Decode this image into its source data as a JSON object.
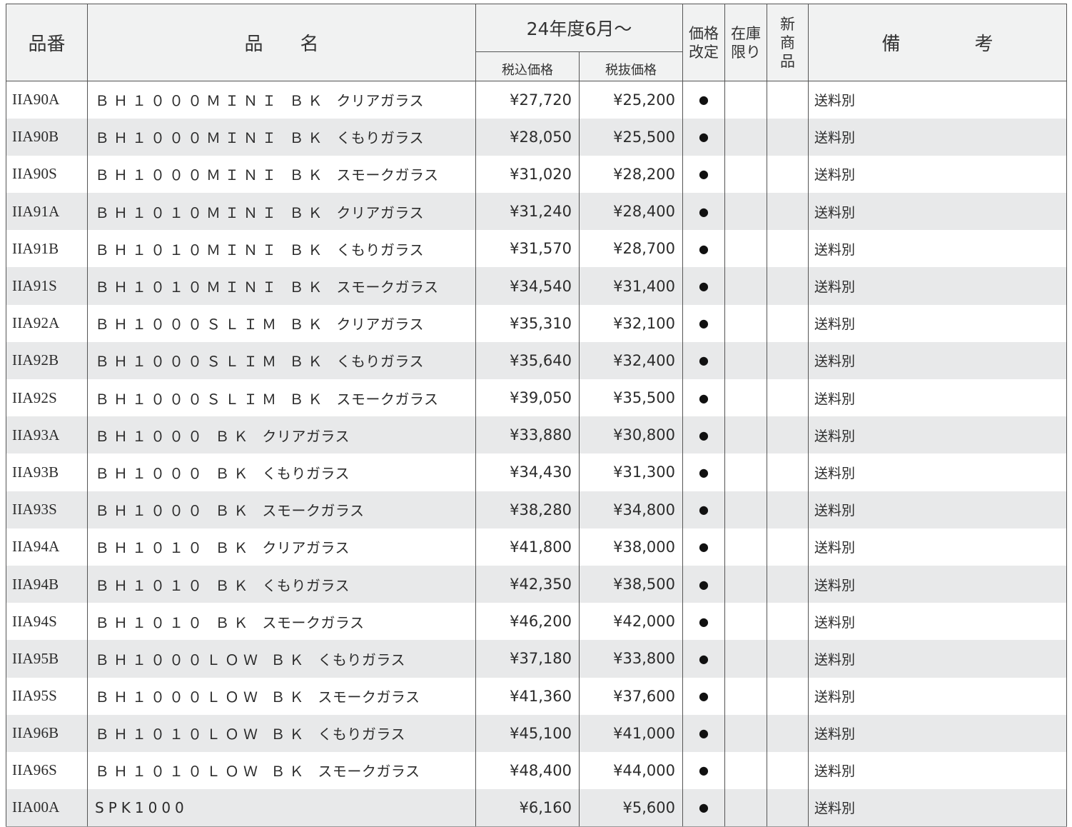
{
  "header": {
    "code": "品番",
    "name": "品　　名",
    "period": "24年度6月～",
    "tax_incl": "税込価格",
    "tax_excl": "税抜価格",
    "revision_1": "価格",
    "revision_2": "改定",
    "stock_1": "在庫",
    "stock_2": "限り",
    "new_1": "新",
    "new_2": "商",
    "new_3": "品",
    "remarks": "備　　　　考"
  },
  "rows": [
    {
      "code": "IIA90A",
      "model": "ＢＨ１０００ＭＩＮＩ ＢＫ",
      "desc": "クリアガラス",
      "incl": "¥27,720",
      "excl": "¥25,200",
      "revision": "●",
      "stock": "",
      "new": "",
      "remark": "送料別"
    },
    {
      "code": "IIA90B",
      "model": "ＢＨ１０００ＭＩＮＩ ＢＫ",
      "desc": "くもりガラス",
      "incl": "¥28,050",
      "excl": "¥25,500",
      "revision": "●",
      "stock": "",
      "new": "",
      "remark": "送料別"
    },
    {
      "code": "IIA90S",
      "model": "ＢＨ１０００ＭＩＮＩ ＢＫ",
      "desc": "スモークガラス",
      "incl": "¥31,020",
      "excl": "¥28,200",
      "revision": "●",
      "stock": "",
      "new": "",
      "remark": "送料別"
    },
    {
      "code": "IIA91A",
      "model": "ＢＨ１０１０ＭＩＮＩ ＢＫ",
      "desc": "クリアガラス",
      "incl": "¥31,240",
      "excl": "¥28,400",
      "revision": "●",
      "stock": "",
      "new": "",
      "remark": "送料別"
    },
    {
      "code": "IIA91B",
      "model": "ＢＨ１０１０ＭＩＮＩ ＢＫ",
      "desc": "くもりガラス",
      "incl": "¥31,570",
      "excl": "¥28,700",
      "revision": "●",
      "stock": "",
      "new": "",
      "remark": "送料別"
    },
    {
      "code": "IIA91S",
      "model": "ＢＨ１０１０ＭＩＮＩ ＢＫ",
      "desc": "スモークガラス",
      "incl": "¥34,540",
      "excl": "¥31,400",
      "revision": "●",
      "stock": "",
      "new": "",
      "remark": "送料別"
    },
    {
      "code": "IIA92A",
      "model": "ＢＨ１０００ＳＬＩＭ ＢＫ",
      "desc": "クリアガラス",
      "incl": "¥35,310",
      "excl": "¥32,100",
      "revision": "●",
      "stock": "",
      "new": "",
      "remark": "送料別"
    },
    {
      "code": "IIA92B",
      "model": "ＢＨ１０００ＳＬＩＭ ＢＫ",
      "desc": "くもりガラス",
      "incl": "¥35,640",
      "excl": "¥32,400",
      "revision": "●",
      "stock": "",
      "new": "",
      "remark": "送料別"
    },
    {
      "code": "IIA92S",
      "model": "ＢＨ１０００ＳＬＩＭ ＢＫ",
      "desc": "スモークガラス",
      "incl": "¥39,050",
      "excl": "¥35,500",
      "revision": "●",
      "stock": "",
      "new": "",
      "remark": "送料別"
    },
    {
      "code": "IIA93A",
      "model": "ＢＨ１０００ ＢＫ",
      "desc": "クリアガラス",
      "incl": "¥33,880",
      "excl": "¥30,800",
      "revision": "●",
      "stock": "",
      "new": "",
      "remark": "送料別"
    },
    {
      "code": "IIA93B",
      "model": "ＢＨ１０００ ＢＫ",
      "desc": "くもりガラス",
      "incl": "¥34,430",
      "excl": "¥31,300",
      "revision": "●",
      "stock": "",
      "new": "",
      "remark": "送料別"
    },
    {
      "code": "IIA93S",
      "model": "ＢＨ１０００ ＢＫ",
      "desc": "スモークガラス",
      "incl": "¥38,280",
      "excl": "¥34,800",
      "revision": "●",
      "stock": "",
      "new": "",
      "remark": "送料別"
    },
    {
      "code": "IIA94A",
      "model": "ＢＨ１０１０ ＢＫ",
      "desc": "クリアガラス",
      "incl": "¥41,800",
      "excl": "¥38,000",
      "revision": "●",
      "stock": "",
      "new": "",
      "remark": "送料別"
    },
    {
      "code": "IIA94B",
      "model": "ＢＨ１０１０ ＢＫ",
      "desc": "くもりガラス",
      "incl": "¥42,350",
      "excl": "¥38,500",
      "revision": "●",
      "stock": "",
      "new": "",
      "remark": "送料別"
    },
    {
      "code": "IIA94S",
      "model": "ＢＨ１０１０ ＢＫ",
      "desc": "スモークガラス",
      "incl": "¥46,200",
      "excl": "¥42,000",
      "revision": "●",
      "stock": "",
      "new": "",
      "remark": "送料別"
    },
    {
      "code": "IIA95B",
      "model": "ＢＨ１０００ＬＯＷ ＢＫ",
      "desc": "くもりガラス",
      "incl": "¥37,180",
      "excl": "¥33,800",
      "revision": "●",
      "stock": "",
      "new": "",
      "remark": "送料別"
    },
    {
      "code": "IIA95S",
      "model": "ＢＨ１０００ＬＯＷ ＢＫ",
      "desc": "スモークガラス",
      "incl": "¥41,360",
      "excl": "¥37,600",
      "revision": "●",
      "stock": "",
      "new": "",
      "remark": "送料別"
    },
    {
      "code": "IIA96B",
      "model": "ＢＨ１０１０ＬＯＷ ＢＫ",
      "desc": "くもりガラス",
      "incl": "¥45,100",
      "excl": "¥41,000",
      "revision": "●",
      "stock": "",
      "new": "",
      "remark": "送料別"
    },
    {
      "code": "IIA96S",
      "model": "ＢＨ１０１０ＬＯＷ ＢＫ",
      "desc": "スモークガラス",
      "incl": "¥48,400",
      "excl": "¥44,000",
      "revision": "●",
      "stock": "",
      "new": "",
      "remark": "送料別"
    },
    {
      "code": "IIA00A",
      "model": "SPK1000",
      "desc": "",
      "incl": "¥6,160",
      "excl": "¥5,600",
      "revision": "●",
      "stock": "",
      "new": "",
      "remark": "送料別"
    }
  ]
}
